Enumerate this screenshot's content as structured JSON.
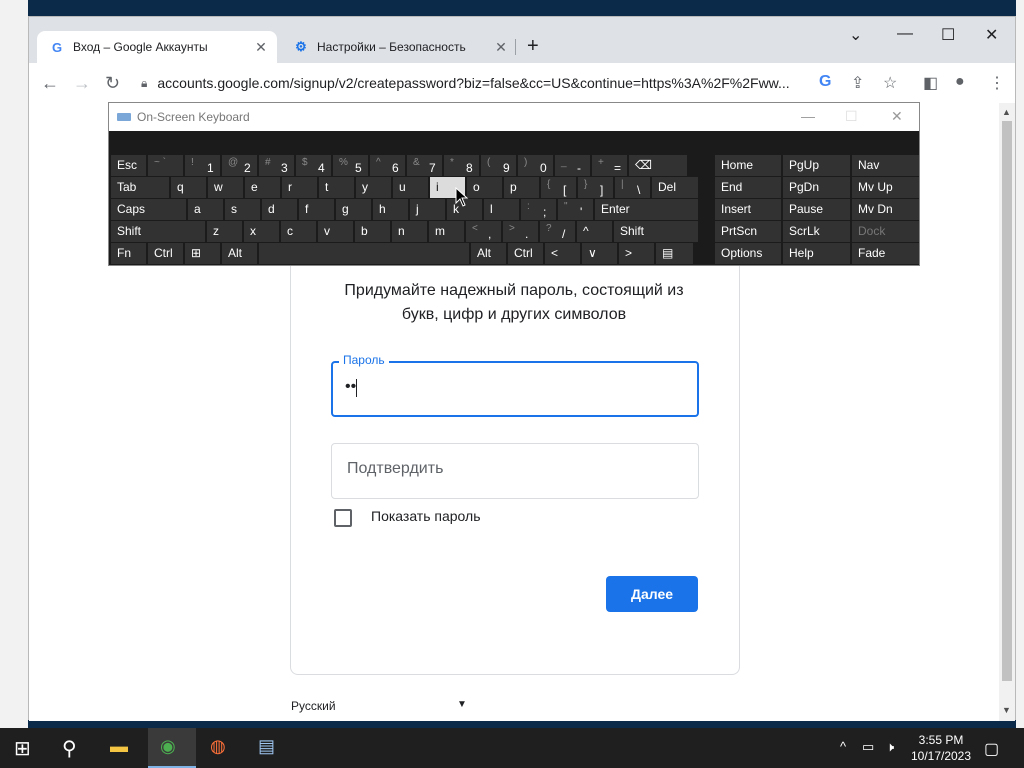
{
  "browser": {
    "tabs": [
      {
        "title": "Вход – Google Аккаунты",
        "favicon": "google-g-icon"
      },
      {
        "title": "Настройки – Безопасность",
        "favicon": "gear-icon"
      }
    ],
    "url": "accounts.google.com/signup/v2/createpassword?biz=false&cc=US&continue=https%3A%2F%2Fww..."
  },
  "page": {
    "subtitle": "Придумайте надежный пароль, состоящий из букв, цифр и других символов",
    "password_label": "Пароль",
    "password_value": "••",
    "confirm_placeholder": "Подтвердить",
    "show_password_label": "Показать пароль",
    "next_button": "Далее",
    "language": "Русский"
  },
  "osk": {
    "title": "On-Screen Keyboard",
    "rows": [
      [
        {
          "label": "Esc"
        },
        {
          "sub": "~ `",
          "label": ""
        },
        {
          "sub": "!",
          "label": "1"
        },
        {
          "sub": "@",
          "label": "2"
        },
        {
          "sub": "#",
          "label": "3"
        },
        {
          "sub": "$",
          "label": "4"
        },
        {
          "sub": "%",
          "label": "5"
        },
        {
          "sub": "^",
          "label": "6"
        },
        {
          "sub": "&",
          "label": "7"
        },
        {
          "sub": "*",
          "label": "8"
        },
        {
          "sub": "(",
          "label": "9"
        },
        {
          "sub": ")",
          "label": "0"
        },
        {
          "sub": "_",
          "label": "-"
        },
        {
          "sub": "+",
          "label": "="
        },
        {
          "label": "⌫"
        }
      ],
      [
        {
          "label": "Tab"
        },
        {
          "label": "q"
        },
        {
          "label": "w"
        },
        {
          "label": "e"
        },
        {
          "label": "r"
        },
        {
          "label": "t"
        },
        {
          "label": "y"
        },
        {
          "label": "u"
        },
        {
          "label": "i"
        },
        {
          "label": "o"
        },
        {
          "label": "p"
        },
        {
          "sub": "{",
          "label": "["
        },
        {
          "sub": "}",
          "label": "]"
        },
        {
          "sub": "|",
          "label": "\\"
        },
        {
          "label": "Del"
        }
      ],
      [
        {
          "label": "Caps"
        },
        {
          "label": "a"
        },
        {
          "label": "s"
        },
        {
          "label": "d"
        },
        {
          "label": "f"
        },
        {
          "label": "g"
        },
        {
          "label": "h"
        },
        {
          "label": "j"
        },
        {
          "label": "k"
        },
        {
          "label": "l"
        },
        {
          "sub": ":",
          "label": ";"
        },
        {
          "sub": "\"",
          "label": "'"
        },
        {
          "label": "Enter"
        }
      ],
      [
        {
          "label": "Shift"
        },
        {
          "label": "z"
        },
        {
          "label": "x"
        },
        {
          "label": "c"
        },
        {
          "label": "v"
        },
        {
          "label": "b"
        },
        {
          "label": "n"
        },
        {
          "label": "m"
        },
        {
          "sub": "<",
          "label": ","
        },
        {
          "sub": ">",
          "label": "."
        },
        {
          "sub": "?",
          "label": "/"
        },
        {
          "label": "^"
        },
        {
          "label": "Shift"
        }
      ],
      [
        {
          "label": "Fn"
        },
        {
          "label": "Ctrl"
        },
        {
          "label": "⊞"
        },
        {
          "label": "Alt"
        },
        {
          "label": ""
        },
        {
          "label": "Alt"
        },
        {
          "label": "Ctrl"
        },
        {
          "label": "<"
        },
        {
          "label": "∨"
        },
        {
          "label": ">"
        },
        {
          "label": "▤"
        }
      ]
    ],
    "nav_keys": [
      [
        "Home",
        "PgUp",
        "Nav"
      ],
      [
        "End",
        "PgDn",
        "Mv Up"
      ],
      [
        "Insert",
        "Pause",
        "Mv Dn"
      ],
      [
        "PrtScn",
        "ScrLk",
        "Dock"
      ],
      [
        "Options",
        "Help",
        "Fade"
      ]
    ],
    "highlighted_key": "i"
  },
  "taskbar": {
    "time": "3:55 PM",
    "date": "10/17/2023"
  }
}
